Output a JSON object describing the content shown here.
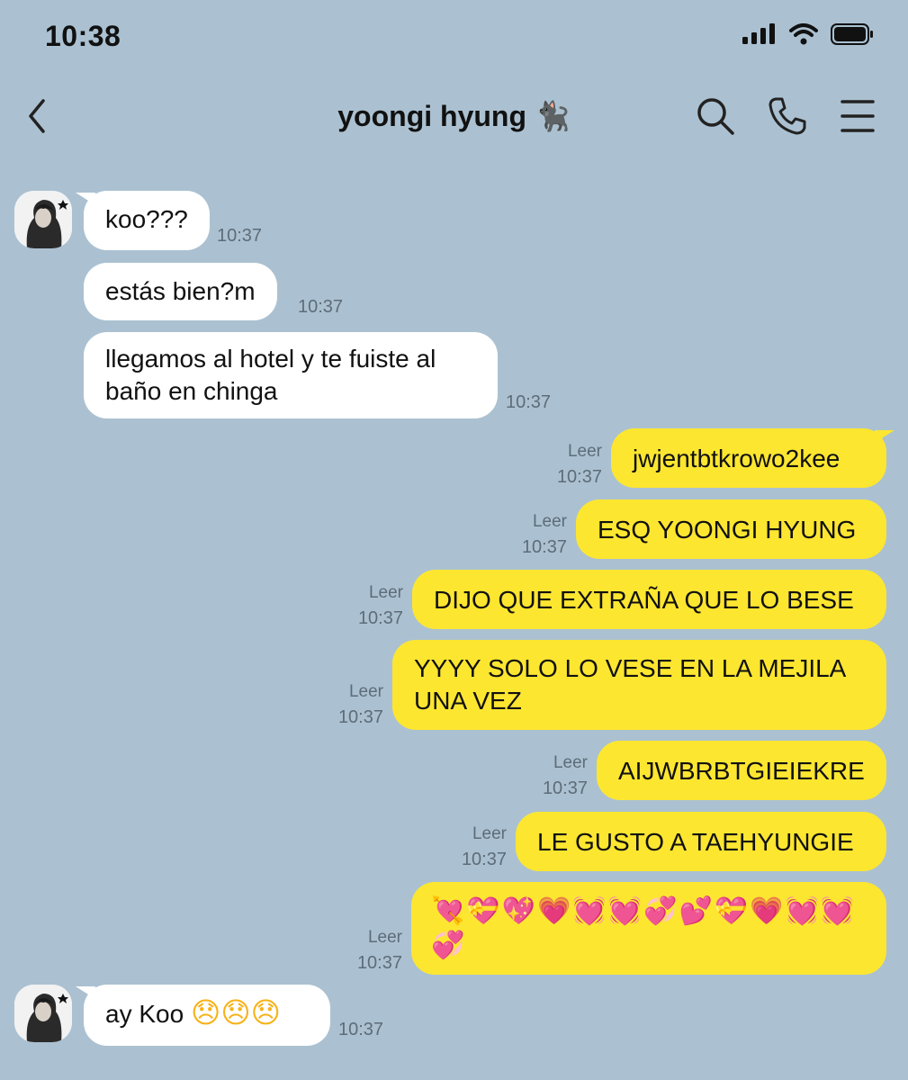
{
  "status": {
    "time": "10:38"
  },
  "header": {
    "title": "yoongi hyung 🐈‍⬛"
  },
  "messages": {
    "m1": {
      "text": "koo???",
      "time": "10:37"
    },
    "m2": {
      "text": "estás bien?m",
      "time": "10:37"
    },
    "m3": {
      "line1": "llegamos al hotel y te fuiste al",
      "line2": "baño en chinga",
      "time": "10:37"
    },
    "m4": {
      "text": "jwjentbtkrowo2kee",
      "read": "Leer",
      "time": "10:37"
    },
    "m5": {
      "text": "ESQ YOONGI HYUNG",
      "read": "Leer",
      "time": "10:37"
    },
    "m6": {
      "text": "DIJO QUE EXTRAÑA QUE LO BESE",
      "read": "Leer",
      "time": "10:37"
    },
    "m7": {
      "line1": "YYYY SOLO LO VESE EN LA MEJILA",
      "line2": "UNA VEZ",
      "read": "Leer",
      "time": "10:37"
    },
    "m8": {
      "text": "AIJWBRBTGIEIEKRE",
      "read": "Leer",
      "time": "10:37"
    },
    "m9": {
      "text": "LE GUSTO A TAEHYUNGIE",
      "read": "Leer",
      "time": "10:37"
    },
    "m10": {
      "line1": "💘💝💖💗💓💓💞💕💝💗💓💓",
      "line2": "💞",
      "read": "Leer",
      "time": "10:37"
    },
    "m11": {
      "text": "ay Koo",
      "emojis": "😞😞😞",
      "time": "10:37"
    }
  },
  "colors": {
    "background": "#abc1d1",
    "outgoing_bubble": "#fde630",
    "incoming_bubble": "#ffffff"
  }
}
